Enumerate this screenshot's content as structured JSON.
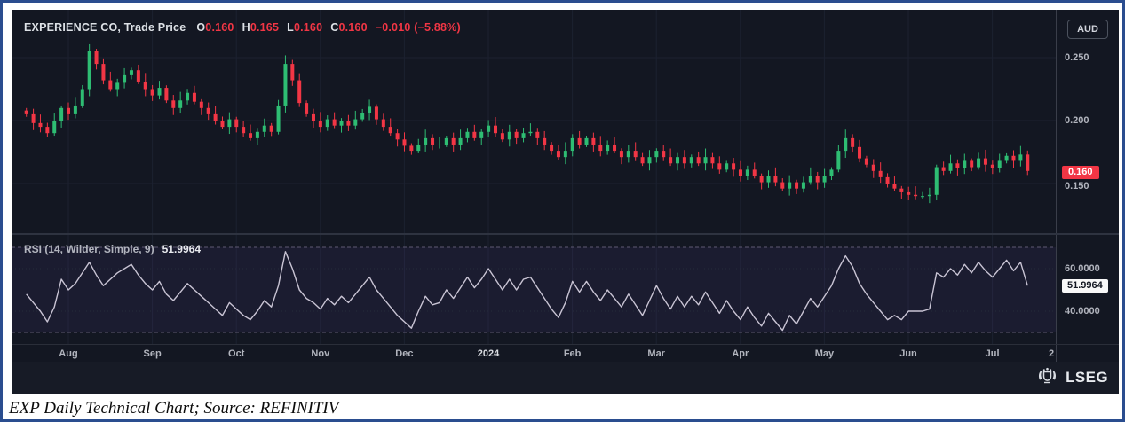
{
  "header": {
    "symbol_label": "EXPERIENCE CO, Trade Price",
    "o_label": "O",
    "o_value": "0.160",
    "h_label": "H",
    "h_value": "0.165",
    "l_label": "L",
    "l_value": "0.160",
    "c_label": "C",
    "c_value": "0.160",
    "change": "−0.010 (−5.88%)"
  },
  "currency_badge": "AUD",
  "price_axis": {
    "ticks": [
      {
        "text": "0.250",
        "price": 0.25
      },
      {
        "text": "0.200",
        "price": 0.2
      },
      {
        "text": "0.150",
        "price": 0.15
      }
    ],
    "last_price_badge": "0.160"
  },
  "rsi_panel": {
    "legend": "RSI (14, Wilder, Simple, 9)",
    "legend_value": "51.9964",
    "tick_60": "60.0000",
    "tick_40": "40.0000",
    "badge": "51.9964"
  },
  "time_axis": {
    "labels": [
      "Aug",
      "Sep",
      "Oct",
      "Nov",
      "Dec",
      "2024",
      "Feb",
      "Mar",
      "Apr",
      "May",
      "Jun",
      "Jul"
    ],
    "year_label": "2024",
    "partial_label": "2"
  },
  "branding": {
    "logo_text": "LSEG"
  },
  "caption": "EXP Daily Technical Chart; Source: REFINITIV",
  "colors": {
    "background": "#131722",
    "up": "#2ebd73",
    "down": "#f23645",
    "grid": "#1c2130",
    "rsi_line": "#c9c4d4",
    "rsi_band_fill": "rgba(122,92,220,0.08)",
    "rsi_band_edge": "#5f5a73",
    "axis_text": "#b2b5be",
    "last_price_bg": "#f23645"
  },
  "chart_data": [
    {
      "type": "candlestick",
      "title": "EXPERIENCE CO, Trade Price",
      "currency": "AUD",
      "ohlc_last": {
        "o": 0.16,
        "h": 0.165,
        "l": 0.16,
        "c": 0.16,
        "change": -0.01,
        "change_pct": -5.88
      },
      "x_labels": [
        "Aug",
        "Sep",
        "Oct",
        "Nov",
        "Dec",
        "2024",
        "Feb",
        "Mar",
        "Apr",
        "May",
        "Jun",
        "Jul"
      ],
      "y_ticks": [
        0.25,
        0.2,
        0.15
      ],
      "ylim": [
        0.11,
        0.275
      ],
      "first_open": 0.208,
      "closes": [
        0.205,
        0.198,
        0.195,
        0.19,
        0.2,
        0.21,
        0.205,
        0.212,
        0.225,
        0.255,
        0.245,
        0.232,
        0.225,
        0.23,
        0.236,
        0.24,
        0.231,
        0.225,
        0.22,
        0.226,
        0.216,
        0.21,
        0.216,
        0.222,
        0.215,
        0.21,
        0.205,
        0.2,
        0.195,
        0.201,
        0.195,
        0.19,
        0.186,
        0.191,
        0.196,
        0.191,
        0.212,
        0.245,
        0.232,
        0.214,
        0.205,
        0.2,
        0.195,
        0.201,
        0.196,
        0.2,
        0.196,
        0.201,
        0.206,
        0.211,
        0.201,
        0.195,
        0.19,
        0.185,
        0.18,
        0.176,
        0.181,
        0.186,
        0.181,
        0.181,
        0.186,
        0.181,
        0.186,
        0.191,
        0.186,
        0.191,
        0.196,
        0.19,
        0.185,
        0.191,
        0.186,
        0.19,
        0.191,
        0.186,
        0.181,
        0.176,
        0.171,
        0.176,
        0.186,
        0.181,
        0.186,
        0.181,
        0.176,
        0.181,
        0.176,
        0.171,
        0.176,
        0.171,
        0.166,
        0.171,
        0.176,
        0.171,
        0.166,
        0.171,
        0.166,
        0.171,
        0.166,
        0.171,
        0.166,
        0.161,
        0.166,
        0.161,
        0.156,
        0.161,
        0.156,
        0.151,
        0.156,
        0.151,
        0.146,
        0.151,
        0.146,
        0.151,
        0.156,
        0.151,
        0.156,
        0.161,
        0.176,
        0.186,
        0.179,
        0.17,
        0.165,
        0.16,
        0.155,
        0.15,
        0.146,
        0.143,
        0.141,
        0.14,
        0.14,
        0.141,
        0.163,
        0.16,
        0.166,
        0.162,
        0.168,
        0.163,
        0.17,
        0.165,
        0.162,
        0.168,
        0.172,
        0.168,
        0.173,
        0.16
      ]
    },
    {
      "type": "line",
      "title": "RSI (14, Wilder, Simple, 9)",
      "last_value": 51.9964,
      "y_ticks": [
        60,
        40
      ],
      "bands": [
        70,
        30
      ],
      "ylim": [
        25,
        75
      ],
      "values": [
        48,
        44,
        40,
        35,
        42,
        55,
        50,
        53,
        58,
        63,
        57,
        52,
        55,
        58,
        60,
        62,
        57,
        53,
        50,
        54,
        48,
        45,
        49,
        53,
        50,
        47,
        44,
        41,
        38,
        44,
        41,
        38,
        36,
        40,
        45,
        42,
        52,
        68,
        60,
        50,
        46,
        44,
        41,
        46,
        43,
        47,
        44,
        48,
        52,
        56,
        50,
        46,
        42,
        38,
        35,
        32,
        40,
        47,
        43,
        44,
        50,
        46,
        51,
        56,
        51,
        55,
        60,
        55,
        50,
        55,
        50,
        55,
        56,
        51,
        46,
        41,
        37,
        44,
        54,
        49,
        54,
        49,
        45,
        50,
        46,
        42,
        48,
        43,
        38,
        45,
        52,
        46,
        41,
        47,
        42,
        47,
        43,
        49,
        44,
        39,
        45,
        40,
        36,
        42,
        37,
        33,
        39,
        35,
        31,
        38,
        34,
        40,
        46,
        42,
        47,
        52,
        60,
        66,
        61,
        53,
        48,
        44,
        40,
        36,
        38,
        36,
        40,
        40,
        40,
        41,
        58,
        56,
        60,
        57,
        62,
        58,
        63,
        59,
        56,
        60,
        64,
        59,
        63,
        52
      ]
    }
  ]
}
